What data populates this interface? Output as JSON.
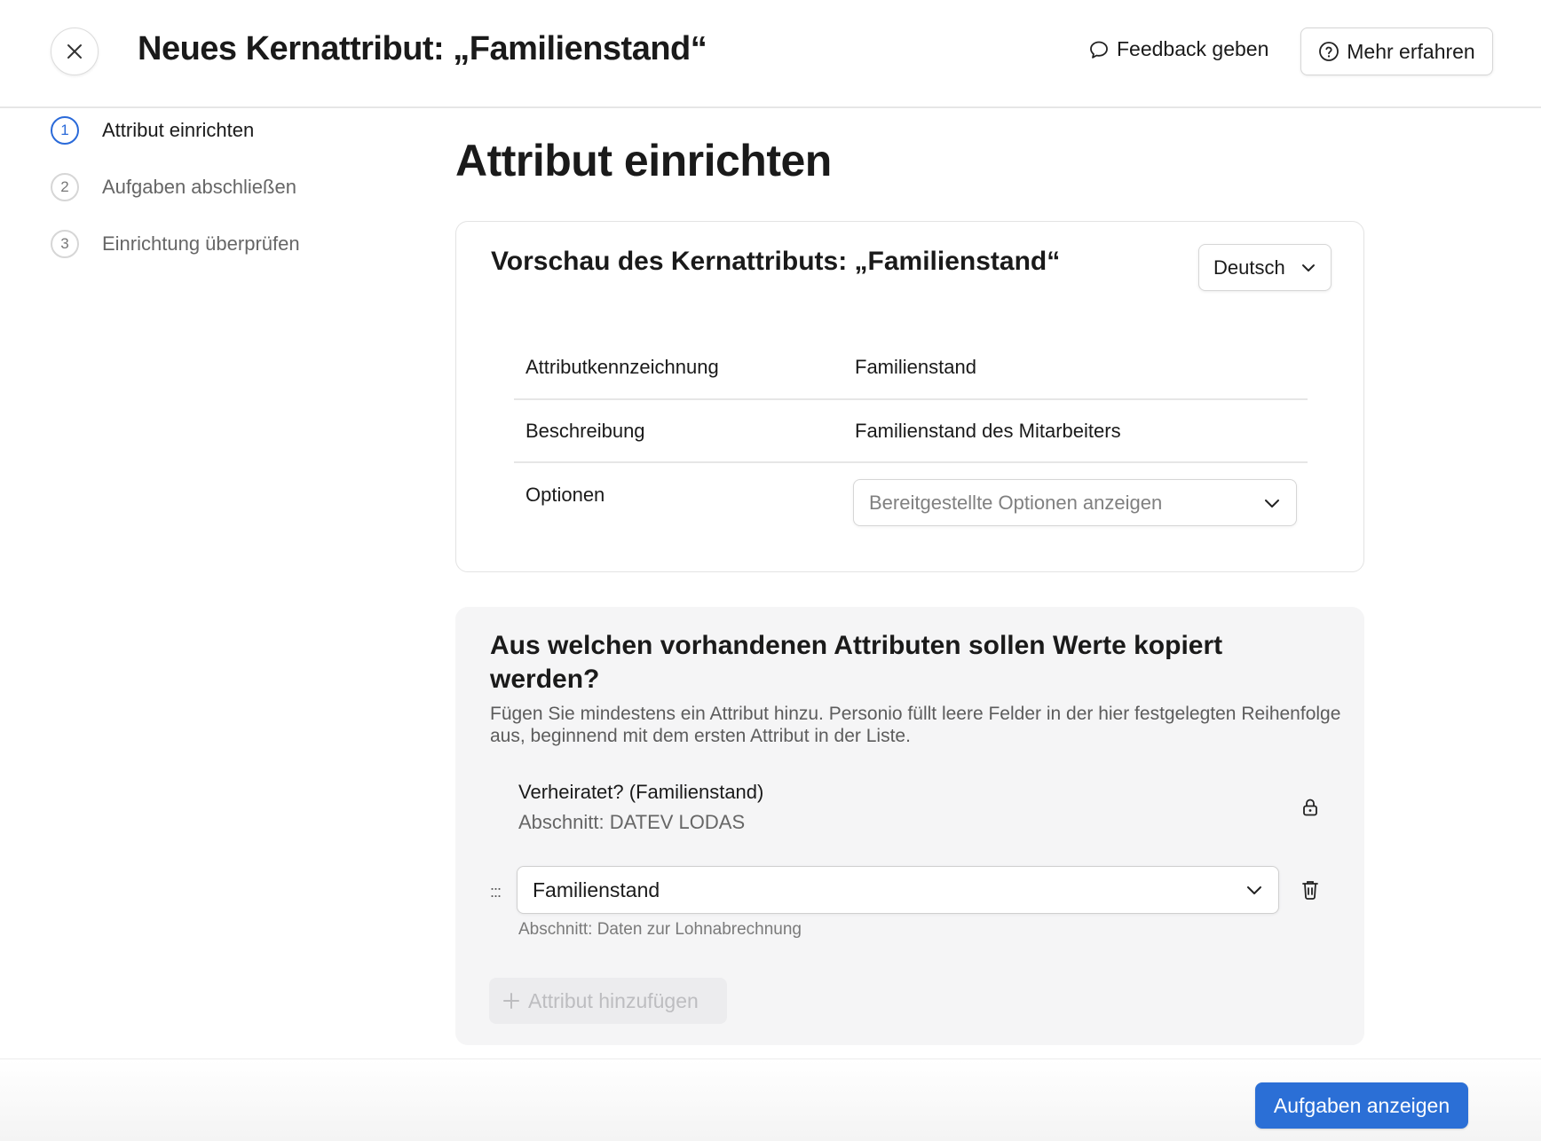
{
  "header": {
    "title": "Neues Kernattribut: „Familienstand“",
    "close_icon": "close-icon",
    "feedback_label": "Feedback geben",
    "feedback_icon": "speech-bubble-icon",
    "learn_more_label": "Mehr erfahren",
    "learn_more_icon": "help-circle-icon"
  },
  "stepper": {
    "steps": [
      {
        "number": "1",
        "label": "Attribut einrichten",
        "active": true
      },
      {
        "number": "2",
        "label": "Aufgaben abschließen",
        "active": false
      },
      {
        "number": "3",
        "label": "Einrichtung überprüfen",
        "active": false
      }
    ]
  },
  "main": {
    "heading": "Attribut einrichten",
    "preview": {
      "title": "Vorschau des Kernattributs: „Familienstand“",
      "language": "Deutsch",
      "rows": [
        {
          "label": "Attributkennzeichnung",
          "value": "Familienstand"
        },
        {
          "label": "Beschreibung",
          "value": "Familienstand des Mitarbeiters"
        },
        {
          "label": "Optionen",
          "placeholder": "Bereitgestellte Optionen anzeigen"
        }
      ]
    },
    "copy": {
      "title": "Aus welchen vorhandenen Attributen sollen Werte kopiert werden?",
      "description": "Fügen Sie mindestens ein Attribut hinzu. Personio füllt leere Felder in der hier festgelegten Reihenfolge aus, beginnend mit dem ersten Attribut in der Liste.",
      "locked_attribute": {
        "name": "Verheiratet? (Familienstand)",
        "section": "Abschnitt: DATEV LODAS",
        "icon": "lock-icon"
      },
      "selected_attribute": {
        "drag_handle": ":::",
        "value": "Familienstand",
        "section": "Abschnitt: Daten zur Lohnabrechnung",
        "icon": "trash-icon"
      },
      "add_label": "Attribut hinzufügen",
      "add_disabled": true
    }
  },
  "footer": {
    "primary_label": "Aufgaben anzeigen",
    "primary_color": "#2b6fd6"
  },
  "colors": {
    "accent": "#2a6ad9",
    "card_gray": "#f5f5f6",
    "border": "#e3e3e3"
  }
}
